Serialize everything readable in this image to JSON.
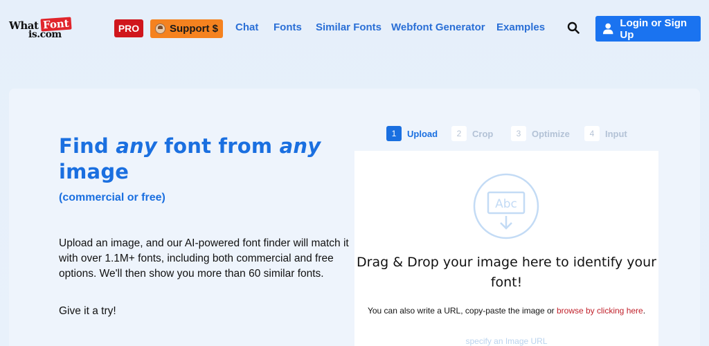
{
  "header": {
    "logo": {
      "what": "What",
      "font": "Font",
      "is": "is.com"
    },
    "pro_label": "PRO",
    "support_label": "Support $",
    "nav": [
      {
        "label": "Chat"
      },
      {
        "label": "Fonts"
      },
      {
        "label": "Similar Fonts"
      },
      {
        "label": "Webfont Generator"
      },
      {
        "label": "Examples"
      }
    ],
    "login_label": "Login or Sign Up"
  },
  "hero": {
    "title_part1": "Find ",
    "title_em1": "any",
    "title_part2": " font from ",
    "title_em2": "any",
    "title_part3": " image",
    "subtitle": "(commercial or free)",
    "description": "Upload an image, and our AI-powered font finder will match it with over 1.1M+ fonts, including both commercial and free options. We'll then show you more than 60 similar fonts.",
    "try_text": "Give it a try!"
  },
  "steps": [
    {
      "num": "1",
      "label": "Upload",
      "active": true
    },
    {
      "num": "2",
      "label": "Crop",
      "active": false
    },
    {
      "num": "3",
      "label": "Optimize",
      "active": false
    },
    {
      "num": "4",
      "label": "Input",
      "active": false
    }
  ],
  "dropzone": {
    "icon_text": "Abc",
    "main_text": "Drag & Drop your image here to identify your font!",
    "alt_text": "You can also write a URL, copy-paste the image or ",
    "browse_link": "browse by clicking here",
    "alt_text_end": ".",
    "url_placeholder": "specify an Image URL"
  },
  "colors": {
    "brand_blue": "#1a6fe0",
    "login_blue": "#1a73f0",
    "pro_red": "#d0161c",
    "support_orange": "#f5821f"
  }
}
